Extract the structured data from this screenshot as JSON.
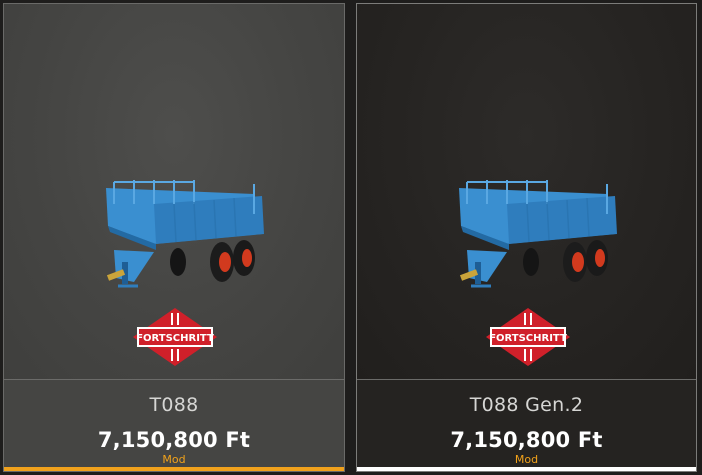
{
  "cards": [
    {
      "name": "T088",
      "price": "7,150,800 Ft",
      "tag": "Mod",
      "brand": "FORTSCHRITT",
      "underline_color": "#f0a11c",
      "state": "selected"
    },
    {
      "name": "T088 Gen.2",
      "price": "7,150,800 Ft",
      "tag": "Mod",
      "brand": "FORTSCHRITT",
      "underline_color": "#ffffff",
      "state": "hover"
    }
  ],
  "colors": {
    "accent": "#f0a11c",
    "trailer_blue": "#3a8fd0",
    "wheel_red": "#d23a1e",
    "brand_red": "#d0202a"
  }
}
